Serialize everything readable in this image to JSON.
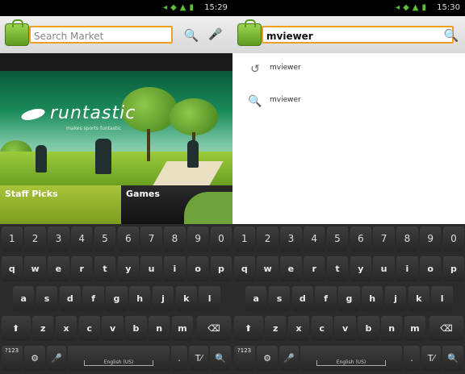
{
  "left": {
    "status": {
      "icons": "◂◆▲▮",
      "time": "15:29"
    },
    "search": {
      "placeholder": "Search Market",
      "search_glyph": "🔍",
      "mic_glyph": "🎤"
    },
    "banner": {
      "brand": "runtastic",
      "tagline": "makes sports funtastic"
    },
    "tiles": [
      {
        "label": "Staff Picks"
      },
      {
        "label": "Games"
      }
    ]
  },
  "right": {
    "status": {
      "icons": "◂◆▲▮",
      "time": "15:30"
    },
    "search": {
      "value": "mviewer",
      "search_glyph": "🔍"
    },
    "suggestions": [
      {
        "icon": "history-icon",
        "glyph": "↺",
        "text": "mviewer"
      },
      {
        "icon": "search-icon",
        "glyph": "🔍",
        "text": "mviewer"
      }
    ]
  },
  "keyboard": {
    "numbers": [
      "1",
      "2",
      "3",
      "4",
      "5",
      "6",
      "7",
      "8",
      "9",
      "0"
    ],
    "row1": [
      "q",
      "w",
      "e",
      "r",
      "t",
      "y",
      "u",
      "i",
      "o",
      "p"
    ],
    "row2": [
      "a",
      "s",
      "d",
      "f",
      "g",
      "h",
      "j",
      "k",
      "l"
    ],
    "row3": [
      "z",
      "x",
      "c",
      "v",
      "b",
      "n",
      "m"
    ],
    "shift": "⬆",
    "backspace": "⌫",
    "symbols": "?123",
    "settings": "⚙",
    "mic": "🎤",
    "space_label": "English (US)",
    "period": ".",
    "enter": "T⁄",
    "search": "🔍"
  }
}
